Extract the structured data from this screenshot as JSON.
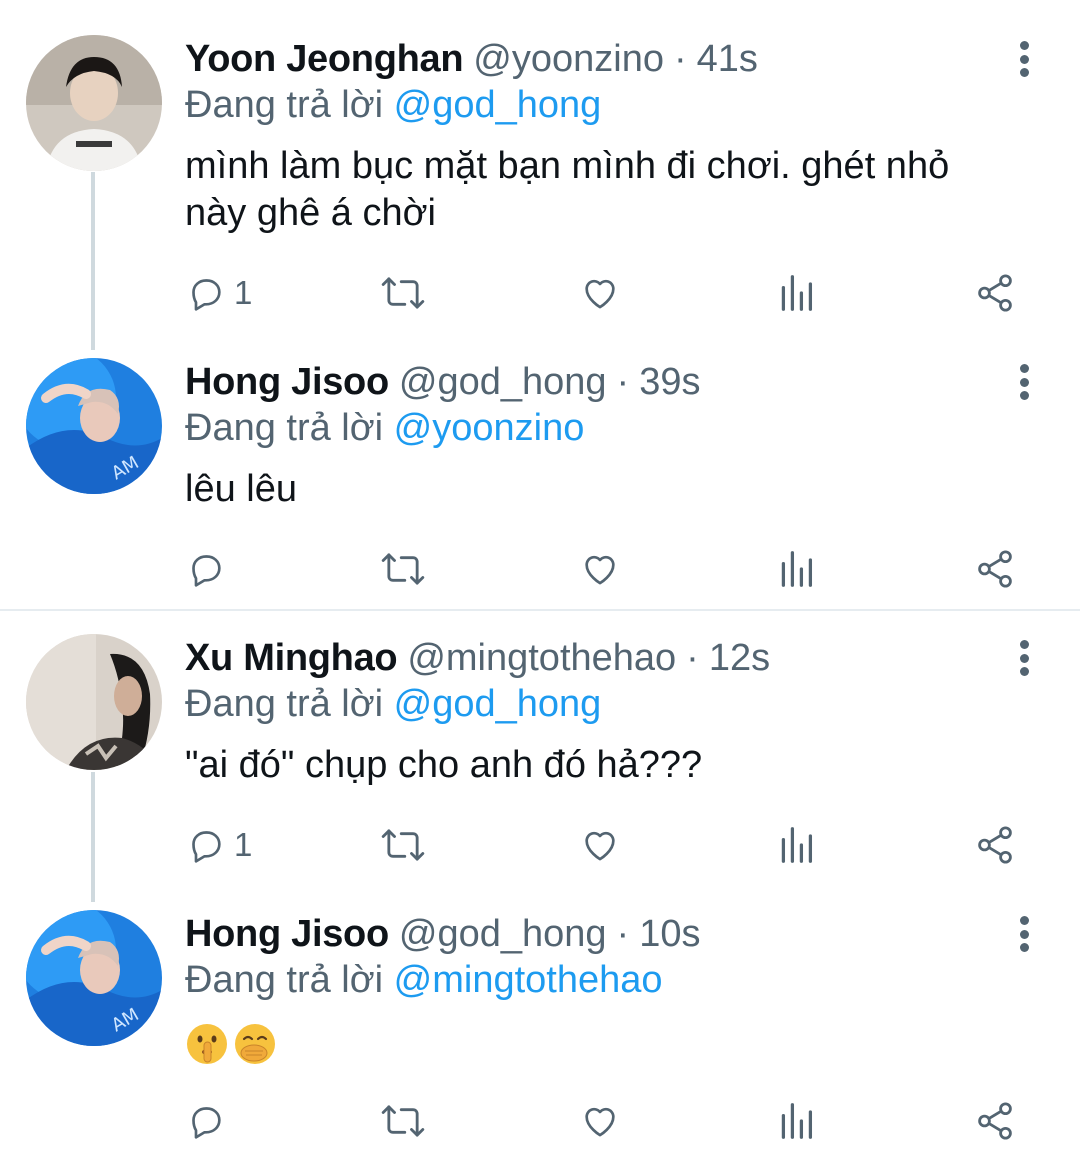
{
  "tweets": [
    {
      "name": "Yoon Jeonghan",
      "handle": "@yoonzino",
      "dot": "·",
      "time": "41s",
      "reply_prefix": "Đang trả lời",
      "reply_mention": "@god_hong",
      "text_lines": [
        "mình làm bục mặt bạn mình đi chơi. ghét nhỏ",
        "này ghê á chời"
      ],
      "reply_count": "1"
    },
    {
      "name": "Hong Jisoo",
      "handle": "@god_hong",
      "dot": "·",
      "time": "39s",
      "reply_prefix": "Đang trả lời",
      "reply_mention": "@yoonzino",
      "text_lines": [
        "lêu lêu"
      ],
      "reply_count": ""
    },
    {
      "name": "Xu Minghao",
      "handle": "@mingtothehao",
      "dot": "·",
      "time": "12s",
      "reply_prefix": "Đang trả lời",
      "reply_mention": "@god_hong",
      "text_lines": [
        "\"ai đó\" chụp cho anh đó hả???"
      ],
      "reply_count": "1"
    },
    {
      "name": "Hong Jisoo",
      "handle": "@god_hong",
      "dot": "·",
      "time": "10s",
      "reply_prefix": "Đang trả lời",
      "reply_mention": "@mingtothehao",
      "emojis": [
        "shushing-face-emoji",
        "face-with-hand-over-mouth-emoji"
      ],
      "reply_count": ""
    }
  ],
  "icons": {
    "reply": "reply-icon",
    "retweet": "retweet-icon",
    "like": "like-icon",
    "analytics": "analytics-icon",
    "share": "share-icon",
    "more": "more-vertical-icon"
  },
  "colors": {
    "text": "#0f1419",
    "secondary": "#536471",
    "link": "#1d9bf0",
    "thread_line": "#cfd9de"
  }
}
